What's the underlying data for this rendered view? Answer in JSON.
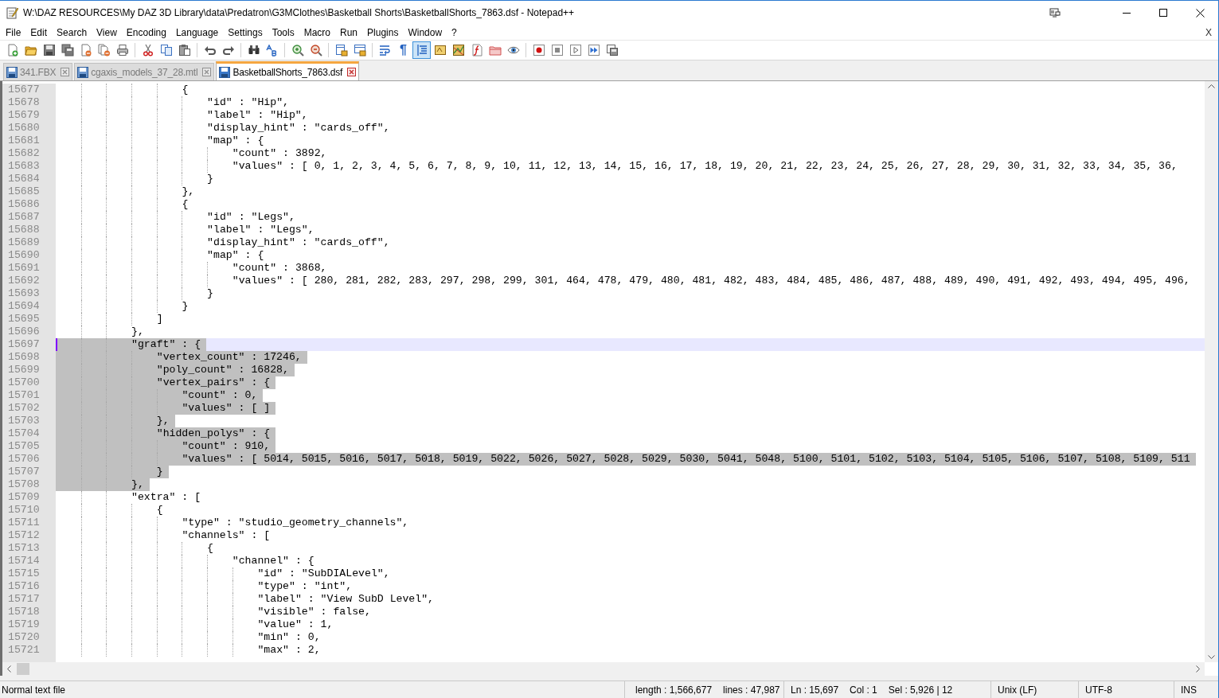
{
  "window": {
    "title": "W:\\DAZ RESOURCES\\My DAZ 3D Library\\data\\Predatron\\G3MClothes\\Basketball Shorts\\BasketballShorts_7863.dsf - Notepad++"
  },
  "menu": [
    "File",
    "Edit",
    "Search",
    "View",
    "Encoding",
    "Language",
    "Settings",
    "Tools",
    "Macro",
    "Run",
    "Plugins",
    "Window",
    "?"
  ],
  "menu_close": "X",
  "toolbar": [
    {
      "kind": "new",
      "pressed": false
    },
    {
      "kind": "open",
      "pressed": false
    },
    {
      "kind": "save",
      "pressed": false
    },
    {
      "kind": "save-all",
      "pressed": false
    },
    {
      "kind": "close",
      "pressed": false
    },
    {
      "kind": "close-all",
      "pressed": false
    },
    {
      "kind": "print",
      "pressed": false
    },
    {
      "kind": "separator"
    },
    {
      "kind": "cut",
      "pressed": false
    },
    {
      "kind": "copy",
      "pressed": false
    },
    {
      "kind": "paste",
      "pressed": false
    },
    {
      "kind": "separator"
    },
    {
      "kind": "undo",
      "pressed": false
    },
    {
      "kind": "redo",
      "pressed": false
    },
    {
      "kind": "separator"
    },
    {
      "kind": "find",
      "pressed": false
    },
    {
      "kind": "replace",
      "pressed": false
    },
    {
      "kind": "separator"
    },
    {
      "kind": "zoom-in",
      "pressed": false
    },
    {
      "kind": "zoom-out",
      "pressed": false
    },
    {
      "kind": "separator"
    },
    {
      "kind": "sync-vertical",
      "pressed": false
    },
    {
      "kind": "sync-horizontal",
      "pressed": false
    },
    {
      "kind": "separator"
    },
    {
      "kind": "wrap",
      "pressed": false
    },
    {
      "kind": "pilcrow",
      "label": "¶",
      "pressed": false
    },
    {
      "kind": "indent-guide",
      "pressed": true
    },
    {
      "kind": "language",
      "pressed": false
    },
    {
      "kind": "map",
      "pressed": false
    },
    {
      "kind": "function-list",
      "pressed": false
    },
    {
      "kind": "folder-workspace",
      "pressed": false
    },
    {
      "kind": "monitor",
      "pressed": false
    },
    {
      "kind": "separator"
    },
    {
      "kind": "record",
      "pressed": false
    },
    {
      "kind": "stop",
      "pressed": false
    },
    {
      "kind": "play",
      "pressed": false
    },
    {
      "kind": "play-multiple",
      "pressed": false
    },
    {
      "kind": "save-macro",
      "pressed": false
    }
  ],
  "tabs": [
    {
      "label": "341.FBX",
      "selected": false
    },
    {
      "label": "cgaxis_models_37_28.mtl",
      "selected": false
    },
    {
      "label": "BasketballShorts_7863.dsf",
      "selected": true
    }
  ],
  "editor": {
    "lines": [
      {
        "number": "15677",
        "text": "                    {",
        "selected": false,
        "current": false
      },
      {
        "number": "15678",
        "text": "                        \"id\" : \"Hip\",",
        "selected": false,
        "current": false
      },
      {
        "number": "15679",
        "text": "                        \"label\" : \"Hip\",",
        "selected": false,
        "current": false
      },
      {
        "number": "15680",
        "text": "                        \"display_hint\" : \"cards_off\",",
        "selected": false,
        "current": false
      },
      {
        "number": "15681",
        "text": "                        \"map\" : {",
        "selected": false,
        "current": false
      },
      {
        "number": "15682",
        "text": "                            \"count\" : 3892,",
        "selected": false,
        "current": false
      },
      {
        "number": "15683",
        "text": "                            \"values\" : [ 0, 1, 2, 3, 4, 5, 6, 7, 8, 9, 10, 11, 12, 13, 14, 15, 16, 17, 18, 19, 20, 21, 22, 23, 24, 25, 26, 27, 28, 29, 30, 31, 32, 33, 34, 35, 36,",
        "selected": false,
        "current": false
      },
      {
        "number": "15684",
        "text": "                        }",
        "selected": false,
        "current": false
      },
      {
        "number": "15685",
        "text": "                    },",
        "selected": false,
        "current": false
      },
      {
        "number": "15686",
        "text": "                    {",
        "selected": false,
        "current": false
      },
      {
        "number": "15687",
        "text": "                        \"id\" : \"Legs\",",
        "selected": false,
        "current": false
      },
      {
        "number": "15688",
        "text": "                        \"label\" : \"Legs\",",
        "selected": false,
        "current": false
      },
      {
        "number": "15689",
        "text": "                        \"display_hint\" : \"cards_off\",",
        "selected": false,
        "current": false
      },
      {
        "number": "15690",
        "text": "                        \"map\" : {",
        "selected": false,
        "current": false
      },
      {
        "number": "15691",
        "text": "                            \"count\" : 3868,",
        "selected": false,
        "current": false
      },
      {
        "number": "15692",
        "text": "                            \"values\" : [ 280, 281, 282, 283, 297, 298, 299, 301, 464, 478, 479, 480, 481, 482, 483, 484, 485, 486, 487, 488, 489, 490, 491, 492, 493, 494, 495, 496,",
        "selected": false,
        "current": false
      },
      {
        "number": "15693",
        "text": "                        }",
        "selected": false,
        "current": false
      },
      {
        "number": "15694",
        "text": "                    }",
        "selected": false,
        "current": false
      },
      {
        "number": "15695",
        "text": "                ]",
        "selected": false,
        "current": false
      },
      {
        "number": "15696",
        "text": "            },",
        "selected": false,
        "current": false
      },
      {
        "number": "15697",
        "text": "            \"graft\" : {",
        "selected": true,
        "current": true
      },
      {
        "number": "15698",
        "text": "                \"vertex_count\" : 17246,",
        "selected": true,
        "current": false
      },
      {
        "number": "15699",
        "text": "                \"poly_count\" : 16828,",
        "selected": true,
        "current": false
      },
      {
        "number": "15700",
        "text": "                \"vertex_pairs\" : {",
        "selected": true,
        "current": false
      },
      {
        "number": "15701",
        "text": "                    \"count\" : 0,",
        "selected": true,
        "current": false
      },
      {
        "number": "15702",
        "text": "                    \"values\" : [ ]",
        "selected": true,
        "current": false
      },
      {
        "number": "15703",
        "text": "                },",
        "selected": true,
        "current": false
      },
      {
        "number": "15704",
        "text": "                \"hidden_polys\" : {",
        "selected": true,
        "current": false
      },
      {
        "number": "15705",
        "text": "                    \"count\" : 910,",
        "selected": true,
        "current": false
      },
      {
        "number": "15706",
        "text": "                    \"values\" : [ 5014, 5015, 5016, 5017, 5018, 5019, 5022, 5026, 5027, 5028, 5029, 5030, 5041, 5048, 5100, 5101, 5102, 5103, 5104, 5105, 5106, 5107, 5108, 5109, 511",
        "selected": true,
        "current": false
      },
      {
        "number": "15707",
        "text": "                }",
        "selected": true,
        "current": false
      },
      {
        "number": "15708",
        "text": "            },",
        "selected": true,
        "current": false
      },
      {
        "number": "15709",
        "text": "            \"extra\" : [",
        "selected": false,
        "current": false
      },
      {
        "number": "15710",
        "text": "                {",
        "selected": false,
        "current": false
      },
      {
        "number": "15711",
        "text": "                    \"type\" : \"studio_geometry_channels\",",
        "selected": false,
        "current": false
      },
      {
        "number": "15712",
        "text": "                    \"channels\" : [",
        "selected": false,
        "current": false
      },
      {
        "number": "15713",
        "text": "                        {",
        "selected": false,
        "current": false
      },
      {
        "number": "15714",
        "text": "                            \"channel\" : {",
        "selected": false,
        "current": false
      },
      {
        "number": "15715",
        "text": "                                \"id\" : \"SubDIALevel\",",
        "selected": false,
        "current": false
      },
      {
        "number": "15716",
        "text": "                                \"type\" : \"int\",",
        "selected": false,
        "current": false
      },
      {
        "number": "15717",
        "text": "                                \"label\" : \"View SubD Level\",",
        "selected": false,
        "current": false
      },
      {
        "number": "15718",
        "text": "                                \"visible\" : false,",
        "selected": false,
        "current": false
      },
      {
        "number": "15719",
        "text": "                                \"value\" : 1,",
        "selected": false,
        "current": false
      },
      {
        "number": "15720",
        "text": "                                \"min\" : 0,",
        "selected": false,
        "current": false
      },
      {
        "number": "15721",
        "text": "                                \"max\" : 2,",
        "selected": false,
        "current": false
      }
    ]
  },
  "status_bar": {
    "file_type": "Normal text file",
    "length": "length : 1,566,677",
    "lines": "lines : 47,987",
    "line": "Ln : 15,697",
    "column": "Col : 1",
    "selection": "Sel : 5,926 | 12",
    "eol": "Unix (LF)",
    "encoding": "UTF-8",
    "mode": "INS"
  }
}
